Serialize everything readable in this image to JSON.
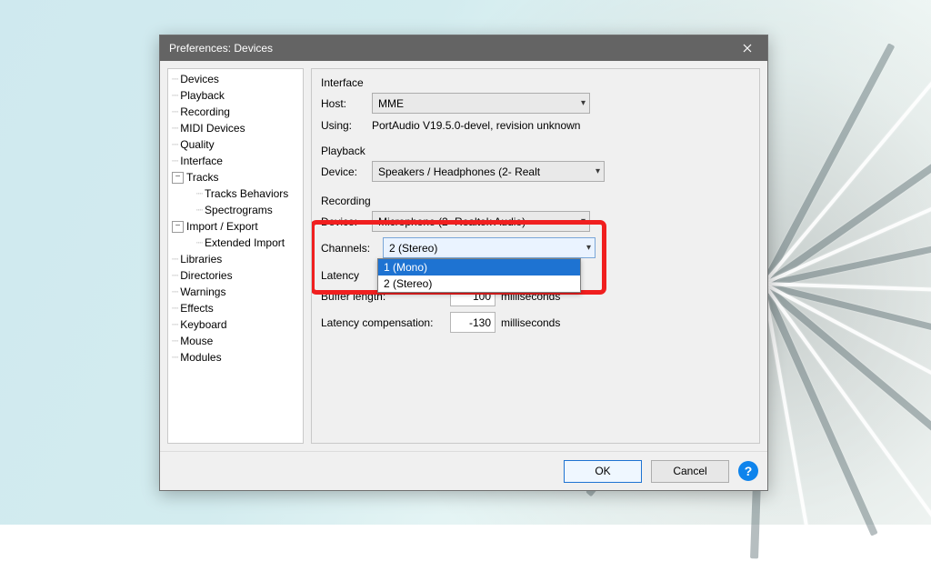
{
  "window": {
    "title": "Preferences: Devices"
  },
  "sidebar": {
    "items": [
      {
        "label": "Devices",
        "depth": 0,
        "expander": ""
      },
      {
        "label": "Playback",
        "depth": 0,
        "expander": ""
      },
      {
        "label": "Recording",
        "depth": 0,
        "expander": ""
      },
      {
        "label": "MIDI Devices",
        "depth": 0,
        "expander": ""
      },
      {
        "label": "Quality",
        "depth": 0,
        "expander": ""
      },
      {
        "label": "Interface",
        "depth": 0,
        "expander": ""
      },
      {
        "label": "Tracks",
        "depth": 0,
        "expander": "minus"
      },
      {
        "label": "Tracks Behaviors",
        "depth": 1,
        "expander": ""
      },
      {
        "label": "Spectrograms",
        "depth": 1,
        "expander": ""
      },
      {
        "label": "Import / Export",
        "depth": 0,
        "expander": "minus"
      },
      {
        "label": "Extended Import",
        "depth": 1,
        "expander": ""
      },
      {
        "label": "Libraries",
        "depth": 0,
        "expander": ""
      },
      {
        "label": "Directories",
        "depth": 0,
        "expander": ""
      },
      {
        "label": "Warnings",
        "depth": 0,
        "expander": ""
      },
      {
        "label": "Effects",
        "depth": 0,
        "expander": ""
      },
      {
        "label": "Keyboard",
        "depth": 0,
        "expander": ""
      },
      {
        "label": "Mouse",
        "depth": 0,
        "expander": ""
      },
      {
        "label": "Modules",
        "depth": 0,
        "expander": ""
      }
    ]
  },
  "main": {
    "interface": {
      "title": "Interface",
      "host_label": "Host:",
      "host_value": "MME",
      "using_label": "Using:",
      "using_value": "PortAudio V19.5.0-devel, revision unknown"
    },
    "playback": {
      "title": "Playback",
      "device_label": "Device:",
      "device_value": "Speakers / Headphones (2- Realt"
    },
    "recording": {
      "title": "Recording",
      "device_label": "Device:",
      "device_value": "Microphone (2- Realtek Audio)",
      "channels_label": "Channels:",
      "channels_value": "2 (Stereo)",
      "channels_options": [
        "1 (Mono)",
        "2 (Stereo)"
      ],
      "channels_selected_index": 0
    },
    "latency": {
      "title": "Latency",
      "buffer_label": "Buffer length:",
      "buffer_value": "100",
      "buffer_units": "milliseconds",
      "comp_label": "Latency compensation:",
      "comp_value": "-130",
      "comp_units": "milliseconds"
    }
  },
  "footer": {
    "ok": "OK",
    "cancel": "Cancel",
    "help": "?"
  }
}
